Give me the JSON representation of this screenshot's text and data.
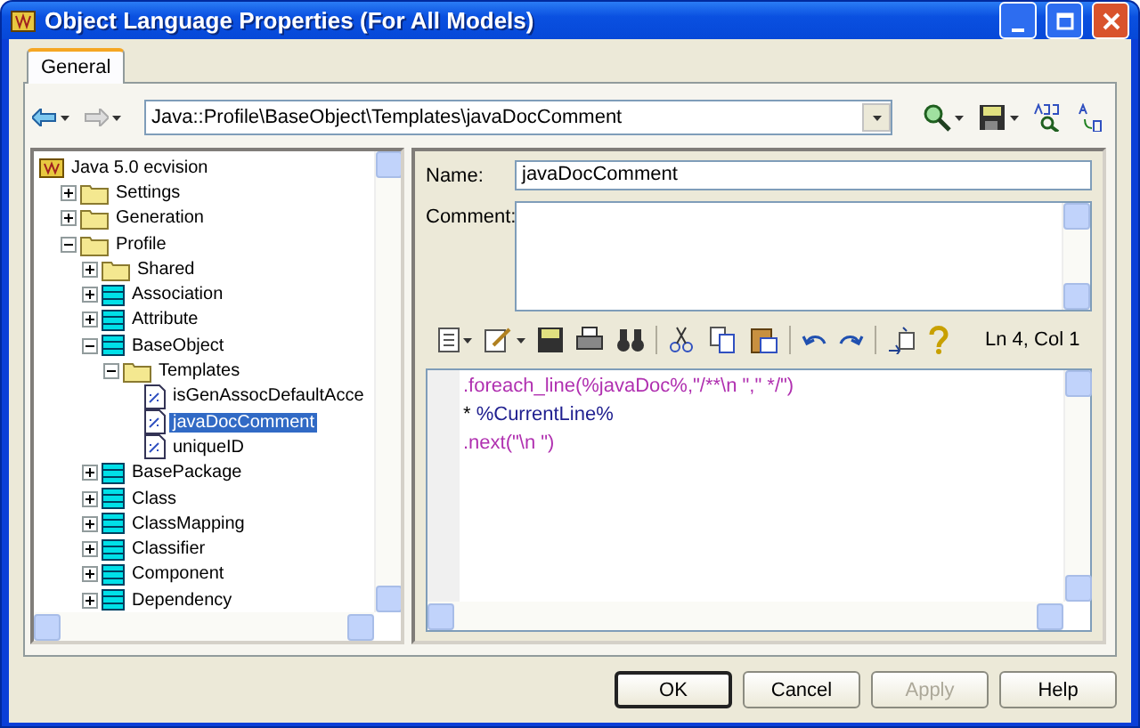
{
  "window": {
    "title": "Object Language Properties (For All Models)"
  },
  "tabs": [
    {
      "label": "General",
      "selected": true
    }
  ],
  "path_field": {
    "value": "Java::Profile\\BaseObject\\Templates\\javaDocComment"
  },
  "tree": [
    {
      "label": "Java 5.0 ecvision",
      "kind": "root",
      "selected": false,
      "children": [
        {
          "label": "Settings",
          "kind": "folder",
          "expanded": false,
          "selected": false
        },
        {
          "label": "Generation",
          "kind": "folder",
          "expanded": false,
          "selected": false
        },
        {
          "label": "Profile",
          "kind": "folder",
          "expanded": true,
          "selected": false,
          "children": [
            {
              "label": "Shared",
              "kind": "folder",
              "expanded": false,
              "selected": false
            },
            {
              "label": "Association",
              "kind": "class",
              "expanded": false,
              "selected": false
            },
            {
              "label": "Attribute",
              "kind": "class",
              "expanded": false,
              "selected": false
            },
            {
              "label": "BaseObject",
              "kind": "class",
              "expanded": true,
              "selected": false,
              "children": [
                {
                  "label": "Templates",
                  "kind": "folder",
                  "expanded": true,
                  "selected": false,
                  "children": [
                    {
                      "label": "isGenAssocDefaultAcce",
                      "kind": "template",
                      "selected": false
                    },
                    {
                      "label": "javaDocComment",
                      "kind": "template",
                      "selected": true
                    },
                    {
                      "label": "uniqueID",
                      "kind": "template",
                      "selected": false
                    }
                  ]
                }
              ]
            },
            {
              "label": "BasePackage",
              "kind": "class",
              "expanded": false,
              "selected": false
            },
            {
              "label": "Class",
              "kind": "class",
              "expanded": false,
              "selected": false
            },
            {
              "label": "ClassMapping",
              "kind": "class",
              "expanded": false,
              "selected": false
            },
            {
              "label": "Classifier",
              "kind": "class",
              "expanded": false,
              "selected": false
            },
            {
              "label": "Component",
              "kind": "class",
              "expanded": false,
              "selected": false
            },
            {
              "label": "Dependency",
              "kind": "class",
              "expanded": false,
              "selected": false
            }
          ]
        }
      ]
    }
  ],
  "name_field": {
    "label": "Name:",
    "value": "javaDocComment"
  },
  "comment_field": {
    "label": "Comment:"
  },
  "editor": {
    "cursor_position": "Ln 4, Col 1",
    "lines": [
      [
        {
          "kind": "macro",
          "text": ".foreach_line(%javaDoc%,\"/**\\n \",\" */\")"
        }
      ],
      [
        {
          "kind": "text",
          "text": "* "
        },
        {
          "kind": "variable",
          "text": "%CurrentLine%"
        }
      ],
      [
        {
          "kind": "macro",
          "text": ".next(\"\\n \")"
        }
      ]
    ]
  },
  "buttons": [
    {
      "label": "OK",
      "default": true,
      "disabled": false
    },
    {
      "label": "Cancel",
      "default": false,
      "disabled": false
    },
    {
      "label": "Apply",
      "default": false,
      "disabled": true
    },
    {
      "label": "Help",
      "default": false,
      "disabled": false
    }
  ]
}
